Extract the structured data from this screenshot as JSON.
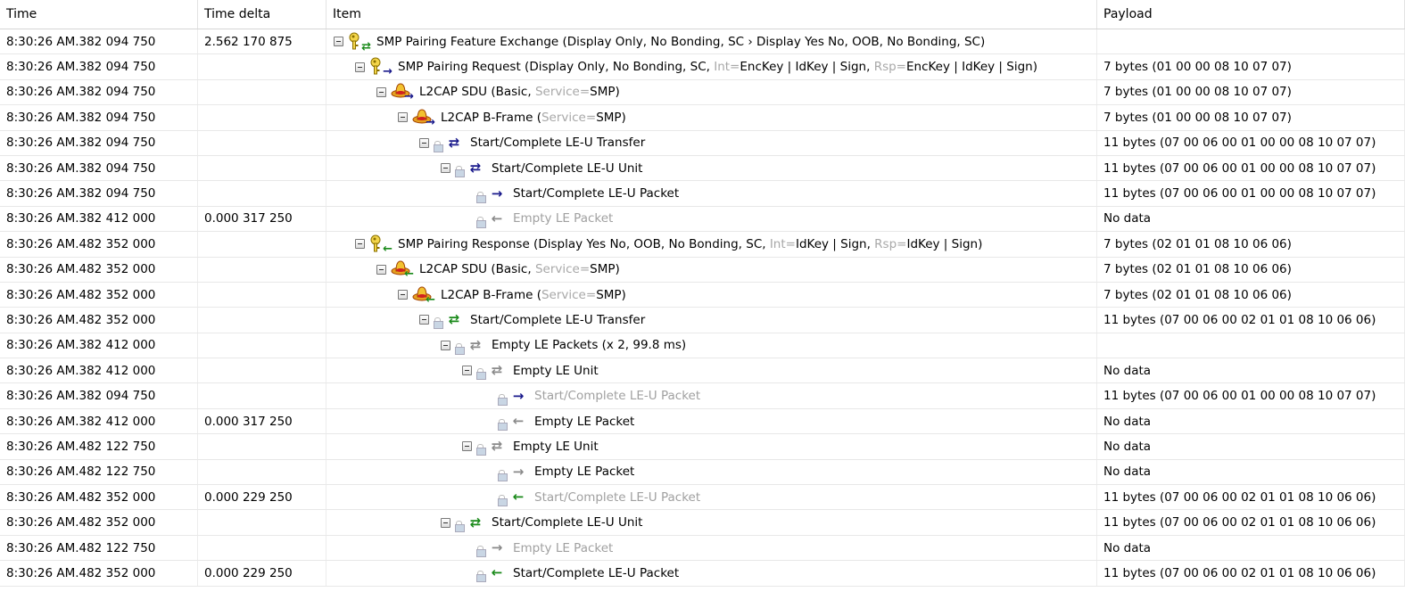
{
  "columns": [
    "Time",
    "Time delta",
    "Item",
    "Payload"
  ],
  "colors": {
    "out": "#1a1a8c",
    "in": "#1a8a1a",
    "gray": "#8a8a8a",
    "dimtext": "#a0a0a0"
  },
  "rows": [
    {
      "time": "8:30:26 AM.382 094 750",
      "delta": "2.562 170 875",
      "level": 0,
      "exp": true,
      "icon": "key",
      "arrow": "both-mixed",
      "dim": false,
      "segs": [
        [
          "SMP Pairing Feature Exchange (Display Only, No Bonding, SC › Display Yes No, OOB, No Bonding, SC)",
          0
        ]
      ],
      "payload": ""
    },
    {
      "time": "8:30:26 AM.382 094 750",
      "delta": "",
      "level": 1,
      "exp": true,
      "icon": "key",
      "arrow": "out",
      "dim": false,
      "segs": [
        [
          "SMP Pairing Request (Display Only, No Bonding, SC, ",
          0
        ],
        [
          "Int=",
          1
        ],
        [
          "EncKey | IdKey | Sign, ",
          0
        ],
        [
          "Rsp=",
          1
        ],
        [
          "EncKey | IdKey | Sign)",
          0
        ]
      ],
      "payload": "7 bytes (01 00 00 08 10 07 07)"
    },
    {
      "time": "8:30:26 AM.382 094 750",
      "delta": "",
      "level": 2,
      "exp": true,
      "icon": "hat",
      "arrow": "out",
      "dim": false,
      "segs": [
        [
          "L2CAP SDU (Basic, ",
          0
        ],
        [
          "Service=",
          1
        ],
        [
          "SMP)",
          0
        ]
      ],
      "payload": "7 bytes (01 00 00 08 10 07 07)"
    },
    {
      "time": "8:30:26 AM.382 094 750",
      "delta": "",
      "level": 3,
      "exp": true,
      "icon": "hat",
      "arrow": "out",
      "dim": false,
      "segs": [
        [
          "L2CAP B-Frame (",
          0
        ],
        [
          "Service=",
          1
        ],
        [
          "SMP)",
          0
        ]
      ],
      "payload": "7 bytes (01 00 00 08 10 07 07)"
    },
    {
      "time": "8:30:26 AM.382 094 750",
      "delta": "",
      "level": 4,
      "exp": true,
      "icon": "lock",
      "arrow": "dbl-out",
      "dim": false,
      "segs": [
        [
          "Start/Complete LE-U Transfer",
          0
        ]
      ],
      "payload": "11 bytes (07 00 06 00 01 00 00 08 10 07 07)"
    },
    {
      "time": "8:30:26 AM.382 094 750",
      "delta": "",
      "level": 5,
      "exp": true,
      "icon": "lock",
      "arrow": "dbl-out",
      "dim": false,
      "segs": [
        [
          "Start/Complete LE-U Unit",
          0
        ]
      ],
      "payload": "11 bytes (07 00 06 00 01 00 00 08 10 07 07)"
    },
    {
      "time": "8:30:26 AM.382 094 750",
      "delta": "",
      "level": 6,
      "exp": false,
      "icon": "lock",
      "arrow": "out",
      "dim": false,
      "segs": [
        [
          "Start/Complete LE-U Packet",
          0
        ]
      ],
      "payload": "11 bytes (07 00 06 00 01 00 00 08 10 07 07)"
    },
    {
      "time": "8:30:26 AM.382 412 000",
      "delta": "0.000 317 250",
      "level": 6,
      "exp": false,
      "icon": "lock",
      "arrow": "gray-left",
      "dim": true,
      "segs": [
        [
          "Empty LE Packet",
          0
        ]
      ],
      "payload": "No data"
    },
    {
      "time": "8:30:26 AM.482 352 000",
      "delta": "",
      "level": 1,
      "exp": true,
      "icon": "key",
      "arrow": "in",
      "dim": false,
      "segs": [
        [
          "SMP Pairing Response (Display Yes No, OOB, No Bonding, SC, ",
          0
        ],
        [
          "Int=",
          1
        ],
        [
          "IdKey | Sign, ",
          0
        ],
        [
          "Rsp=",
          1
        ],
        [
          "IdKey | Sign)",
          0
        ]
      ],
      "payload": "7 bytes (02 01 01 08 10 06 06)"
    },
    {
      "time": "8:30:26 AM.482 352 000",
      "delta": "",
      "level": 2,
      "exp": true,
      "icon": "hat",
      "arrow": "in",
      "dim": false,
      "segs": [
        [
          "L2CAP SDU (Basic, ",
          0
        ],
        [
          "Service=",
          1
        ],
        [
          "SMP)",
          0
        ]
      ],
      "payload": "7 bytes (02 01 01 08 10 06 06)"
    },
    {
      "time": "8:30:26 AM.482 352 000",
      "delta": "",
      "level": 3,
      "exp": true,
      "icon": "hat",
      "arrow": "in",
      "dim": false,
      "segs": [
        [
          "L2CAP B-Frame (",
          0
        ],
        [
          "Service=",
          1
        ],
        [
          "SMP)",
          0
        ]
      ],
      "payload": "7 bytes (02 01 01 08 10 06 06)"
    },
    {
      "time": "8:30:26 AM.482 352 000",
      "delta": "",
      "level": 4,
      "exp": true,
      "icon": "lock",
      "arrow": "dbl-in",
      "dim": false,
      "segs": [
        [
          "Start/Complete LE-U Transfer",
          0
        ]
      ],
      "payload": "11 bytes (07 00 06 00 02 01 01 08 10 06 06)"
    },
    {
      "time": "8:30:26 AM.382 412 000",
      "delta": "",
      "level": 5,
      "exp": true,
      "icon": "lock",
      "arrow": "dbl-gray",
      "dim": false,
      "segs": [
        [
          "Empty LE Packets (x 2, 99.8 ms)",
          0
        ]
      ],
      "payload": ""
    },
    {
      "time": "8:30:26 AM.382 412 000",
      "delta": "",
      "level": 6,
      "exp": true,
      "icon": "lock",
      "arrow": "dbl-gray",
      "dim": false,
      "segs": [
        [
          "Empty LE Unit",
          0
        ]
      ],
      "payload": "No data"
    },
    {
      "time": "8:30:26 AM.382 094 750",
      "delta": "",
      "level": 7,
      "exp": false,
      "icon": "lock",
      "arrow": "out",
      "dim": true,
      "segs": [
        [
          "Start/Complete LE-U Packet",
          0
        ]
      ],
      "payload": "11 bytes (07 00 06 00 01 00 00 08 10 07 07)"
    },
    {
      "time": "8:30:26 AM.382 412 000",
      "delta": "0.000 317 250",
      "level": 7,
      "exp": false,
      "icon": "lock",
      "arrow": "gray-left",
      "dim": false,
      "segs": [
        [
          "Empty LE Packet",
          0
        ]
      ],
      "payload": "No data"
    },
    {
      "time": "8:30:26 AM.482 122 750",
      "delta": "",
      "level": 6,
      "exp": true,
      "icon": "lock",
      "arrow": "dbl-gray",
      "dim": false,
      "segs": [
        [
          "Empty LE Unit",
          0
        ]
      ],
      "payload": "No data"
    },
    {
      "time": "8:30:26 AM.482 122 750",
      "delta": "",
      "level": 7,
      "exp": false,
      "icon": "lock",
      "arrow": "gray-right",
      "dim": false,
      "segs": [
        [
          "Empty LE Packet",
          0
        ]
      ],
      "payload": "No data"
    },
    {
      "time": "8:30:26 AM.482 352 000",
      "delta": "0.000 229 250",
      "level": 7,
      "exp": false,
      "icon": "lock",
      "arrow": "in",
      "dim": true,
      "segs": [
        [
          "Start/Complete LE-U Packet",
          0
        ]
      ],
      "payload": "11 bytes (07 00 06 00 02 01 01 08 10 06 06)"
    },
    {
      "time": "8:30:26 AM.482 352 000",
      "delta": "",
      "level": 5,
      "exp": true,
      "icon": "lock",
      "arrow": "dbl-in",
      "dim": false,
      "segs": [
        [
          "Start/Complete LE-U Unit",
          0
        ]
      ],
      "payload": "11 bytes (07 00 06 00 02 01 01 08 10 06 06)"
    },
    {
      "time": "8:30:26 AM.482 122 750",
      "delta": "",
      "level": 6,
      "exp": false,
      "icon": "lock",
      "arrow": "gray-right",
      "dim": true,
      "segs": [
        [
          "Empty LE Packet",
          0
        ]
      ],
      "payload": "No data"
    },
    {
      "time": "8:30:26 AM.482 352 000",
      "delta": "0.000 229 250",
      "level": 6,
      "exp": false,
      "icon": "lock",
      "arrow": "in",
      "dim": false,
      "segs": [
        [
          "Start/Complete LE-U Packet",
          0
        ]
      ],
      "payload": "11 bytes (07 00 06 00 02 01 01 08 10 06 06)"
    }
  ]
}
